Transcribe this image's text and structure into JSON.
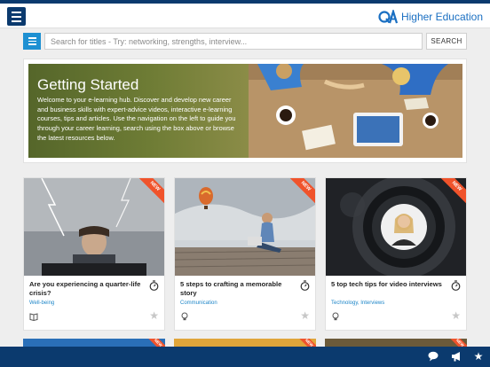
{
  "header": {
    "brand_name": "Higher Education",
    "brand_color": "#1a6fc2",
    "nav_color": "#0b3a6e"
  },
  "search": {
    "placeholder": "Search for titles - Try: networking, strengths, interview...",
    "value": "",
    "button_label": "SEARCH",
    "filter_color": "#1e90d2"
  },
  "hero": {
    "title": "Getting Started",
    "text": "Welcome to your e-learning hub. Discover and develop new career and business skills with expert-advice videos, interactive e-learning courses, tips and articles. Use the navigation on the left to guide you through your career learning, search using the box above or browse the latest resources below."
  },
  "cards": [
    {
      "badge": "NEW",
      "title": "Are you experiencing a quarter-life crisis?",
      "tag": "Well-being",
      "type_icon": "book-icon"
    },
    {
      "badge": "NEW",
      "title": "5 steps to crafting a memorable story",
      "tag": "Communication",
      "type_icon": "lightbulb-icon"
    },
    {
      "badge": "NEW",
      "title": "5 top tech tips for video interviews",
      "tag": "Technology, Interviews",
      "type_icon": "lightbulb-icon"
    }
  ],
  "peek_cards": [
    {
      "badge": "NEW"
    },
    {
      "badge": "NEW"
    },
    {
      "badge": "NEW"
    }
  ],
  "footer": {
    "icons": [
      "chat-icon",
      "megaphone-icon",
      "star-icon"
    ]
  },
  "colors": {
    "ribbon": "#f0532b",
    "tag": "#1e86c8",
    "footer": "#0b3a6e"
  }
}
